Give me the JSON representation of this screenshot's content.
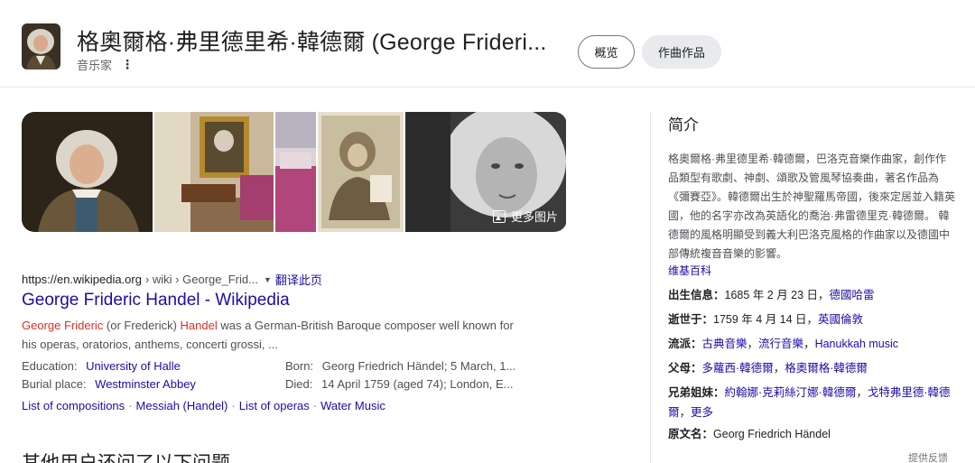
{
  "header": {
    "title": "格奧爾格·弗里德里希·韓德爾 (George Frideri...",
    "subtitle": "音乐家",
    "more_menu": "⋮",
    "tabs": [
      {
        "label": "概览",
        "selected": true
      },
      {
        "label": "作曲作品",
        "selected": false
      }
    ]
  },
  "images": {
    "more_label": "更多图片"
  },
  "result": {
    "url": "https://en.wikipedia.org",
    "path": "› wiki › George_Frid...",
    "translate": "翻译此页",
    "title": "George Frideric Handel - Wikipedia",
    "snippet": {
      "em1": "George Frideric",
      "t1": " (or Frederick) ",
      "em2": "Handel",
      "t2": " was a German-British Baroque composer well known for his operas, oratorios, anthems, concerti grossi, ..."
    },
    "facts": {
      "education_label": "Education:",
      "education_value": "University of Halle",
      "burial_label": "Burial place:",
      "burial_value": "Westminster Abbey",
      "born_label": "Born:",
      "born_value": "Georg Friedrich Händel; 5 March, 1...",
      "died_label": "Died:",
      "died_value": "14 April 1759 (aged 74); London, E..."
    },
    "sitelinks": [
      "List of compositions",
      "Messiah (Handel)",
      "List of operas",
      "Water Music"
    ],
    "sitelink_sep": "·"
  },
  "paa_heading": "其他用户还问了以下问题",
  "knowledge_panel": {
    "title": "简介",
    "description": "格奧爾格·弗里德里希·韓德爾，巴洛克音樂作曲家，創作作品類型有歌劇、神劇、頌歌及管風琴協奏曲，著名作品為《彌賽亞》。韓德爾出生於神聖羅馬帝國，後來定居並入籍英國，他的名字亦改為英語化的喬治·弗雷德里克·韓德爾。 韓德爾的風格明顯受到義大利巴洛克風格的作曲家以及德國中部傳統複音音樂的影響。",
    "source": "维基百科",
    "born": {
      "label": "出生信息：",
      "text": "1685 年 2 月 23 日，",
      "link": "德國哈雷"
    },
    "died": {
      "label": "逝世于：",
      "text": "1759 年 4 月 14 日，",
      "link": "英國倫敦"
    },
    "genre": {
      "label": "流派：",
      "links": [
        "古典音樂",
        "流行音樂",
        "Hanukkah music"
      ],
      "sep": "，"
    },
    "parents": {
      "label": "父母：",
      "links": [
        "多蘿西·韓德爾",
        "格奧爾格·韓德爾"
      ],
      "sep": "，"
    },
    "siblings": {
      "label": "兄弟姐妹：",
      "links": [
        "約翰娜·克莉絲汀娜·韓德爾",
        "戈特弗里德·韓德爾"
      ],
      "sep": "，",
      "more": "更多"
    },
    "original_name": {
      "label": "原文名：",
      "value": "Georg Friedrich Händel"
    }
  },
  "feedback": "提供反馈",
  "icons": {
    "more_images": "image-icon",
    "caret": "caret-down-icon"
  }
}
